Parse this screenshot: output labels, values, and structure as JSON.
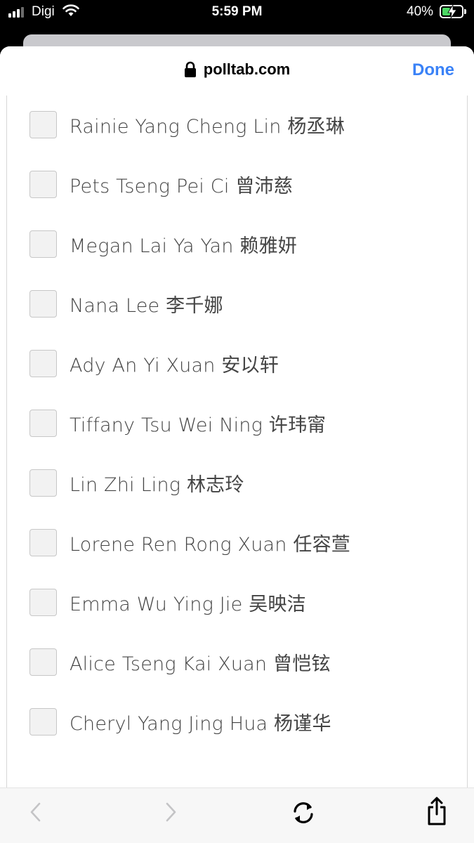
{
  "status_bar": {
    "carrier": "Digi",
    "time": "5:59 PM",
    "battery_percent": "40%",
    "battery_level": 0.4,
    "battery_color": "#4cd964"
  },
  "header": {
    "url": "polltab.com",
    "done_label": "Done",
    "accent_color": "#3a82f7"
  },
  "options": [
    {
      "label": "Rainie Yang Cheng Lin 杨丞琳",
      "checked": false
    },
    {
      "label": "Pets Tseng Pei Ci 曾沛慈",
      "checked": false
    },
    {
      "label": "Megan Lai Ya Yan 赖雅妍",
      "checked": false
    },
    {
      "label": "Nana Lee 李千娜",
      "checked": false
    },
    {
      "label": "Ady An Yi Xuan 安以轩",
      "checked": false
    },
    {
      "label": "Tiffany Tsu Wei Ning 许玮甯",
      "checked": false
    },
    {
      "label": "Lin Zhi Ling 林志玲",
      "checked": false
    },
    {
      "label": "Lorene Ren Rong Xuan 任容萱",
      "checked": false
    },
    {
      "label": "Emma Wu Ying Jie 吴映洁",
      "checked": false
    },
    {
      "label": "Alice Tseng Kai Xuan 曾恺铉",
      "checked": false
    },
    {
      "label": "Cheryl Yang Jing Hua 杨谨华",
      "checked": false
    }
  ],
  "toolbar": {
    "icons": [
      "back-icon",
      "forward-icon",
      "reload-icon",
      "share-icon"
    ]
  }
}
